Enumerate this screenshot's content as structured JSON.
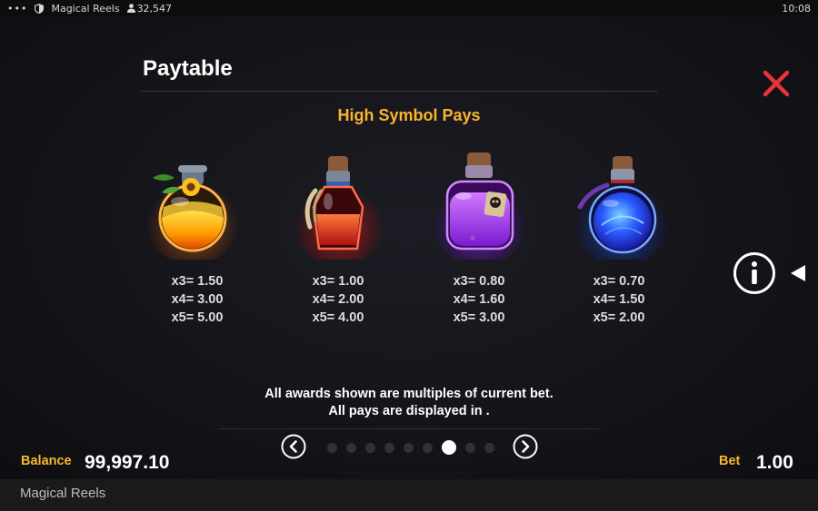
{
  "status_bar": {
    "menu_dots": "•••",
    "app_title": "Magical Reels",
    "player_count": "32,547",
    "time": "10:08",
    "icons": [
      "more-dots-icon",
      "shield-icon",
      "user-icon"
    ]
  },
  "paytable": {
    "title": "Paytable",
    "section_title": "High Symbol Pays",
    "symbols": [
      {
        "name": "orange-potion",
        "pays": [
          "x3= 1.50",
          "x4= 3.00",
          "x5= 5.00"
        ]
      },
      {
        "name": "red-potion",
        "pays": [
          "x3= 1.00",
          "x4= 2.00",
          "x5= 4.00"
        ]
      },
      {
        "name": "purple-potion",
        "pays": [
          "x3= 0.80",
          "x4= 1.60",
          "x5= 3.00"
        ]
      },
      {
        "name": "blue-potion",
        "pays": [
          "x3= 0.70",
          "x4= 1.50",
          "x5= 2.00"
        ]
      }
    ],
    "note_line1": "All awards shown are multiples of current bet.",
    "note_line2": "All pays are displayed in .",
    "pagination": {
      "total": 9,
      "active_index": 6
    }
  },
  "balance": {
    "label": "Balance",
    "value": "99,997.10"
  },
  "bet": {
    "label": "Bet",
    "value": "1.00"
  },
  "footer": {
    "app_name": "Magical Reels"
  },
  "colors": {
    "accent_gold": "#f7b62c",
    "close_red": "#e8323c",
    "background": "#141419"
  }
}
